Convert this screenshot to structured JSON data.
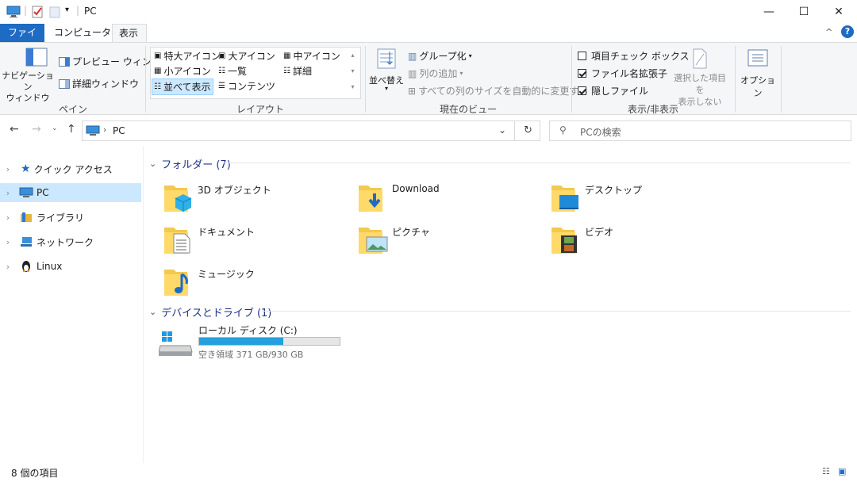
{
  "title": {
    "text": "PC"
  },
  "window": {
    "minimize": "—",
    "maximize": "☐",
    "close": "✕"
  },
  "tabs": [
    {
      "label": "ファイル"
    },
    {
      "label": "コンピューター"
    },
    {
      "label": "表示"
    }
  ],
  "ribbon": {
    "pane": {
      "nav_pane": "ナビゲーション\nウィンドウ",
      "preview_pane": "プレビュー ウィンドウ",
      "details_pane": "詳細ウィンドウ",
      "label": "ペイン"
    },
    "layout": {
      "items": [
        "特大アイコン",
        "大アイコン",
        "中アイコン",
        "小アイコン",
        "一覧",
        "詳細",
        "並べて表示",
        "コンテンツ"
      ],
      "label": "レイアウト"
    },
    "current_view": {
      "sort": "並べ替え",
      "group_by": "グループ化",
      "add_columns": "列の追加",
      "fit_columns": "すべての列のサイズを自動的に変更する",
      "label": "現在のビュー"
    },
    "show_hide": {
      "item_checkboxes": "項目チェック ボックス",
      "file_ext": "ファイル名拡張子",
      "hidden_items": "隠しファイル",
      "hide_selected": "選択した項目を\n表示しない",
      "label": "表示/非表示"
    },
    "options": {
      "label": "オプション"
    }
  },
  "address": {
    "path": "PC",
    "search_placeholder": "PCの検索"
  },
  "sidebar": {
    "items": [
      {
        "label": "クイック アクセス"
      },
      {
        "label": "PC"
      },
      {
        "label": "ライブラリ"
      },
      {
        "label": "ネットワーク"
      },
      {
        "label": "Linux"
      }
    ]
  },
  "folders": {
    "header": "フォルダー (7)",
    "items": [
      {
        "label": "3D オブジェクト"
      },
      {
        "label": "Download"
      },
      {
        "label": "デスクトップ"
      },
      {
        "label": "ドキュメント"
      },
      {
        "label": "ピクチャ"
      },
      {
        "label": "ビデオ"
      },
      {
        "label": "ミュージック"
      }
    ]
  },
  "devices": {
    "header": "デバイスとドライブ (1)",
    "drive": {
      "label": "ローカル ディスク (C:)",
      "free": "空き領域 371 GB/930 GB",
      "used_fraction": 0.6,
      "bar_color": "#26a0da"
    }
  },
  "status": {
    "count": "8 個の項目"
  },
  "colors": {
    "accent": "#1e6bc4",
    "selection": "#cce8ff"
  }
}
